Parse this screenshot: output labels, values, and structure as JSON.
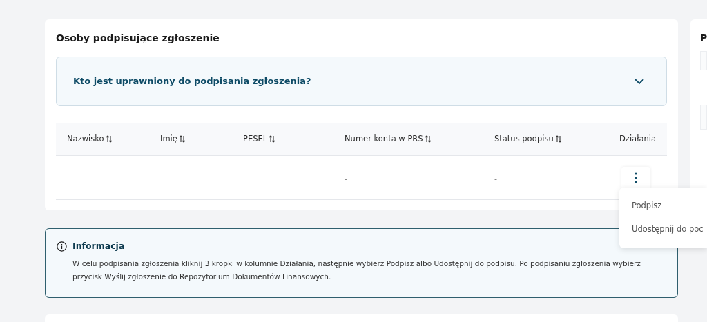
{
  "card": {
    "title": "Osoby podpisujące zgłoszenie",
    "accordion": {
      "title": "Kto jest uprawniony do podpisania zgłoszenia?",
      "expanded": false
    },
    "table": {
      "columns": [
        "Nazwisko",
        "Imię",
        "PESEL",
        "Numer konta w PRS",
        "Status podpisu",
        "Działania"
      ],
      "sortable": [
        true,
        true,
        true,
        true,
        true,
        false
      ],
      "rows": [
        {
          "cells": [
            "",
            "",
            "",
            "-",
            "-"
          ]
        }
      ]
    },
    "menu": {
      "open": true,
      "items": [
        "Podpisz",
        "Udostępnij do poc"
      ]
    }
  },
  "info": {
    "title": "Informacja",
    "text": "W celu podpisania zgłoszenia kliknij 3 kropki w kolumnie Działania, następnie wybierz Podpisz albo Udostępnij do podpisu. Po podpisaniu zgłoszenia wybierz przycisk Wyślij zgłoszenie do Repozytorium Dokumentów Finansowych."
  },
  "side_panel": {
    "title": "P"
  }
}
